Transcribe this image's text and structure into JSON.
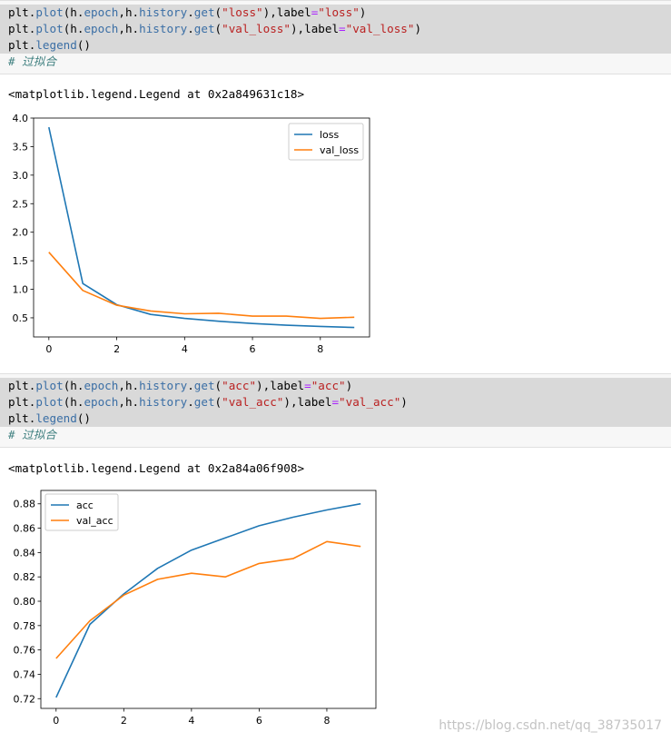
{
  "cells": [
    {
      "code": [
        [
          [
            "plt.",
            ""
          ],
          [
            "plot",
            "fn"
          ],
          [
            "(h.",
            ""
          ],
          [
            "epoch",
            "fn"
          ],
          [
            ",h.",
            ""
          ],
          [
            "history",
            "fn"
          ],
          [
            ".",
            ""
          ],
          [
            "get",
            "fn"
          ],
          [
            "(",
            ""
          ],
          [
            "\"loss\"",
            "str"
          ],
          [
            "),label",
            ""
          ],
          [
            "=",
            "op"
          ],
          [
            "\"loss\"",
            "str"
          ],
          [
            ")",
            ""
          ]
        ],
        [
          [
            "plt.",
            ""
          ],
          [
            "plot",
            "fn"
          ],
          [
            "(h.",
            ""
          ],
          [
            "epoch",
            "fn"
          ],
          [
            ",h.",
            ""
          ],
          [
            "history",
            "fn"
          ],
          [
            ".",
            ""
          ],
          [
            "get",
            "fn"
          ],
          [
            "(",
            ""
          ],
          [
            "\"val_loss\"",
            "str"
          ],
          [
            "),label",
            ""
          ],
          [
            "=",
            "op"
          ],
          [
            "\"val_loss\"",
            "str"
          ],
          [
            ")",
            ""
          ]
        ],
        [
          [
            "plt.",
            ""
          ],
          [
            "legend",
            "fn"
          ],
          [
            "()",
            ""
          ]
        ],
        [
          [
            "# 过拟合",
            "cm"
          ]
        ]
      ],
      "output": "<matplotlib.legend.Legend at 0x2a849631c18>"
    },
    {
      "code": [
        [
          [
            "plt.",
            ""
          ],
          [
            "plot",
            "fn"
          ],
          [
            "(h.",
            ""
          ],
          [
            "epoch",
            "fn"
          ],
          [
            ",h.",
            ""
          ],
          [
            "history",
            "fn"
          ],
          [
            ".",
            ""
          ],
          [
            "get",
            "fn"
          ],
          [
            "(",
            ""
          ],
          [
            "\"acc\"",
            "str"
          ],
          [
            "),label",
            ""
          ],
          [
            "=",
            "op"
          ],
          [
            "\"acc\"",
            "str"
          ],
          [
            ")",
            ""
          ]
        ],
        [
          [
            "plt.",
            ""
          ],
          [
            "plot",
            "fn"
          ],
          [
            "(h.",
            ""
          ],
          [
            "epoch",
            "fn"
          ],
          [
            ",h.",
            ""
          ],
          [
            "history",
            "fn"
          ],
          [
            ".",
            ""
          ],
          [
            "get",
            "fn"
          ],
          [
            "(",
            ""
          ],
          [
            "\"val_acc\"",
            "str"
          ],
          [
            "),label",
            ""
          ],
          [
            "=",
            "op"
          ],
          [
            "\"val_acc\"",
            "str"
          ],
          [
            ")",
            ""
          ]
        ],
        [
          [
            "plt.",
            ""
          ],
          [
            "legend",
            "fn"
          ],
          [
            "()",
            ""
          ]
        ],
        [
          [
            "# 过拟合",
            "cm"
          ]
        ]
      ],
      "output": "<matplotlib.legend.Legend at 0x2a84a06f908>"
    }
  ],
  "chart_data": [
    {
      "type": "line",
      "x": [
        0,
        1,
        2,
        3,
        4,
        5,
        6,
        7,
        8,
        9
      ],
      "xticks": [
        0,
        2,
        4,
        6,
        8
      ],
      "yticks": [
        "0.5",
        "1.0",
        "1.5",
        "2.0",
        "2.5",
        "3.0",
        "3.5",
        "4.0"
      ],
      "xlim": [
        -0.45,
        9.45
      ],
      "ylim": [
        0.165,
        4.0
      ],
      "legend_placement": "upper right",
      "grid": false,
      "series": [
        {
          "name": "loss",
          "color": "#1f77b4",
          "values": [
            3.84,
            1.1,
            0.73,
            0.56,
            0.49,
            0.44,
            0.4,
            0.37,
            0.35,
            0.33
          ]
        },
        {
          "name": "val_loss",
          "color": "#ff7f0e",
          "values": [
            1.65,
            0.98,
            0.72,
            0.62,
            0.57,
            0.58,
            0.53,
            0.53,
            0.49,
            0.51
          ]
        }
      ]
    },
    {
      "type": "line",
      "x": [
        0,
        1,
        2,
        3,
        4,
        5,
        6,
        7,
        8,
        9
      ],
      "xticks": [
        0,
        2,
        4,
        6,
        8
      ],
      "yticks": [
        "0.72",
        "0.74",
        "0.76",
        "0.78",
        "0.80",
        "0.82",
        "0.84",
        "0.86",
        "0.88"
      ],
      "xlim": [
        -0.45,
        9.45
      ],
      "ylim": [
        0.712,
        0.891
      ],
      "legend_placement": "upper left",
      "grid": false,
      "series": [
        {
          "name": "acc",
          "color": "#1f77b4",
          "values": [
            0.721,
            0.781,
            0.806,
            0.827,
            0.842,
            0.852,
            0.862,
            0.869,
            0.875,
            0.88
          ]
        },
        {
          "name": "val_acc",
          "color": "#ff7f0e",
          "values": [
            0.753,
            0.784,
            0.805,
            0.818,
            0.823,
            0.82,
            0.831,
            0.835,
            0.849,
            0.845
          ]
        }
      ]
    }
  ],
  "watermark": "https://blog.csdn.net/qq_38735017"
}
